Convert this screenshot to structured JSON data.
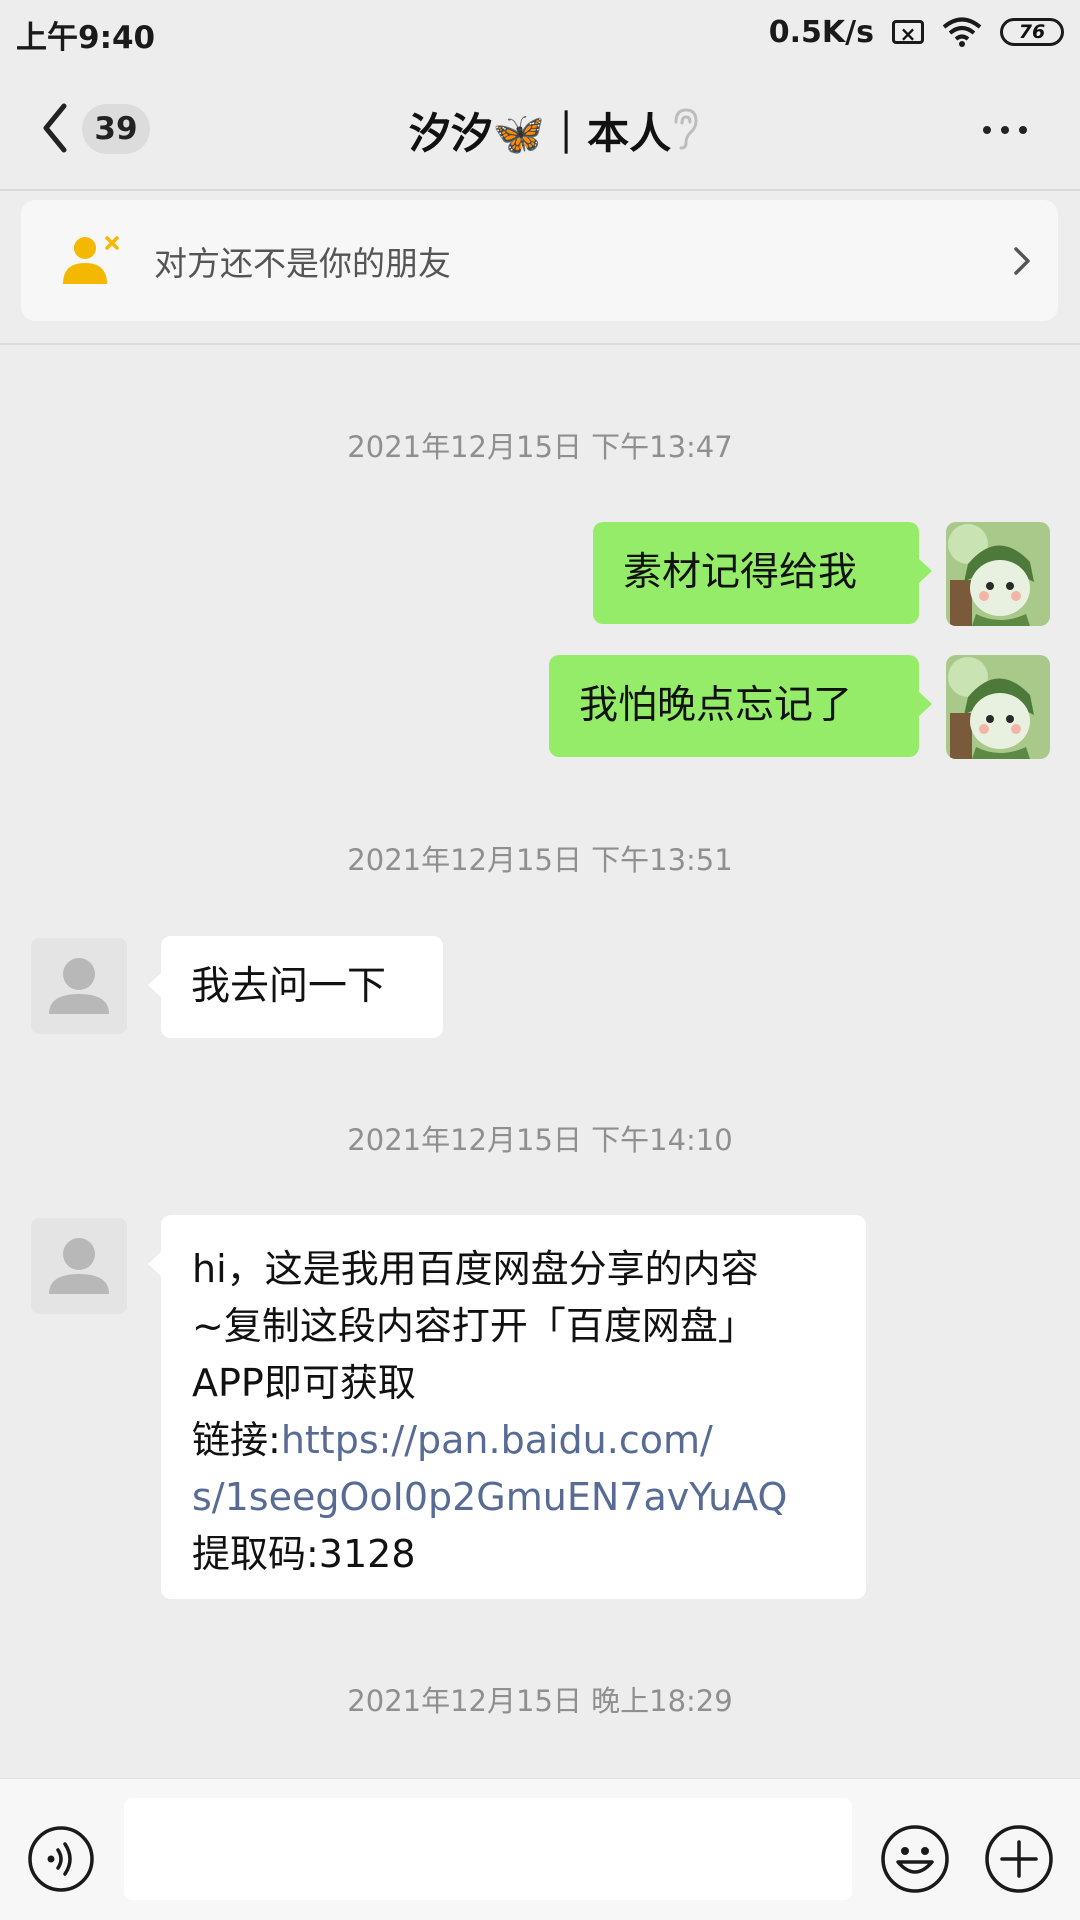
{
  "status_bar": {
    "time": "上午9:40",
    "net_speed": "0.5K/s",
    "sim_label": "×",
    "battery": "76"
  },
  "header": {
    "unread_count": "39",
    "title": "汐汐🦋｜本人",
    "icons": [
      "back-icon",
      "ear-icon",
      "more-icon"
    ]
  },
  "friend_notice": {
    "text": "对方还不是你的朋友",
    "icon": "add-friend-icon"
  },
  "messages": [
    {
      "type": "time",
      "text": "2021年12月15日 下午13:47"
    },
    {
      "type": "sent",
      "text": "素材记得给我"
    },
    {
      "type": "sent",
      "text": "我怕晚点忘记了"
    },
    {
      "type": "time",
      "text": "2021年12月15日 下午13:51"
    },
    {
      "type": "received",
      "text": "我去问一下"
    },
    {
      "type": "time",
      "text": "2021年12月15日 下午14:10"
    },
    {
      "type": "received",
      "lines": [
        "hi，这是我用百度网盘分享的内容",
        "~复制这段内容打开「百度网盘」",
        "APP即可获取"
      ],
      "link_prefix": "链接:",
      "link_line_1": "https://pan.baidu.com/",
      "link_line_2": "s/1seegOoI0p2GmuEN7avYuAQ",
      "code_line": "提取码:3128"
    },
    {
      "type": "time",
      "text": "2021年12月15日 晚上18:29"
    }
  ],
  "input_bar": {
    "placeholder": "",
    "value": "",
    "icons": [
      "voice-icon",
      "emoji-icon",
      "plus-icon"
    ]
  },
  "colors": {
    "sent_bubble": "#95ec69",
    "received_bubble": "#ffffff",
    "background": "#ededed",
    "link": "#576b95",
    "notice_icon": "#f5b800"
  }
}
